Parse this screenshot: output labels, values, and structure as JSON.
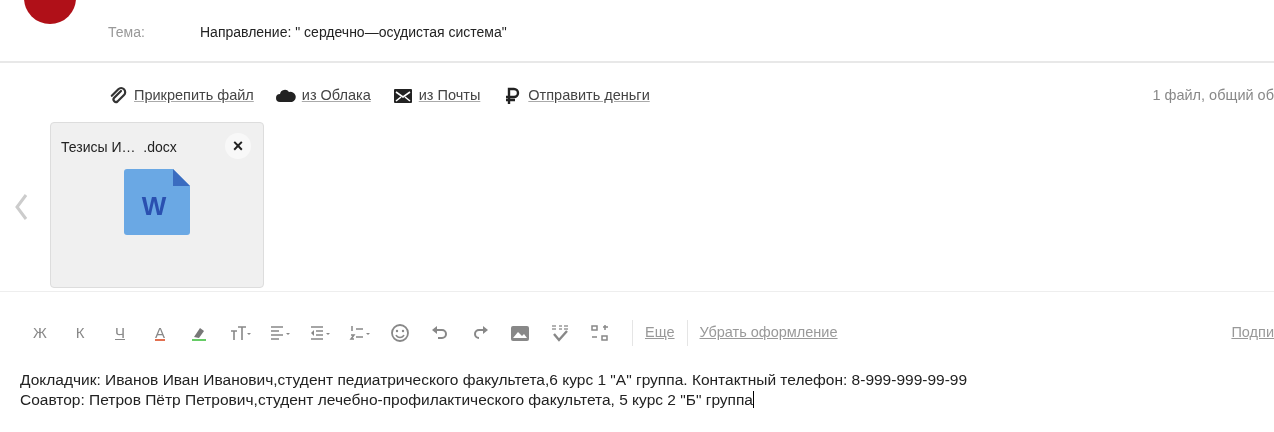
{
  "subject": {
    "label": "Тема:",
    "value": "Направление: \" сердечно—осудистая система\""
  },
  "attach_actions": [
    {
      "kind": "clip",
      "label": "Прикрепить файл"
    },
    {
      "kind": "cloud",
      "label": "из Облака"
    },
    {
      "kind": "mail",
      "label": "из Почты"
    },
    {
      "kind": "ruble",
      "label": "Отправить деньги"
    }
  ],
  "attach_summary": "1 файл, общий об",
  "attachments": [
    {
      "name": "Тезисы И…  .docx",
      "close": "×",
      "icon_letter": "W"
    }
  ],
  "toolbar": [
    {
      "kind": "letter",
      "label": "Ж"
    },
    {
      "kind": "letter",
      "label": "К"
    },
    {
      "kind": "underline",
      "label": "Ч"
    },
    {
      "kind": "color",
      "label": "A"
    },
    {
      "kind": "highlight"
    },
    {
      "kind": "fontsize"
    },
    {
      "kind": "align"
    },
    {
      "kind": "indent"
    },
    {
      "kind": "list"
    },
    {
      "kind": "emoji"
    },
    {
      "kind": "undo"
    },
    {
      "kind": "redo"
    },
    {
      "kind": "image"
    },
    {
      "kind": "spell"
    },
    {
      "kind": "sort"
    }
  ],
  "toolbar_links": [
    "Еще",
    "Убрать оформление"
  ],
  "signature_link": "Подпи",
  "body": [
    "Докладчик: Иванов Иван Иванович,студент педиатрического факультета,6 курс 1 \"А\" группа. Контактный телефон: 8-999-999-99-99",
    "Соавтор: Петров Пётр Петрович,студент лечебно-профилактического факультета, 5 курс 2 \"Б\" группа"
  ]
}
